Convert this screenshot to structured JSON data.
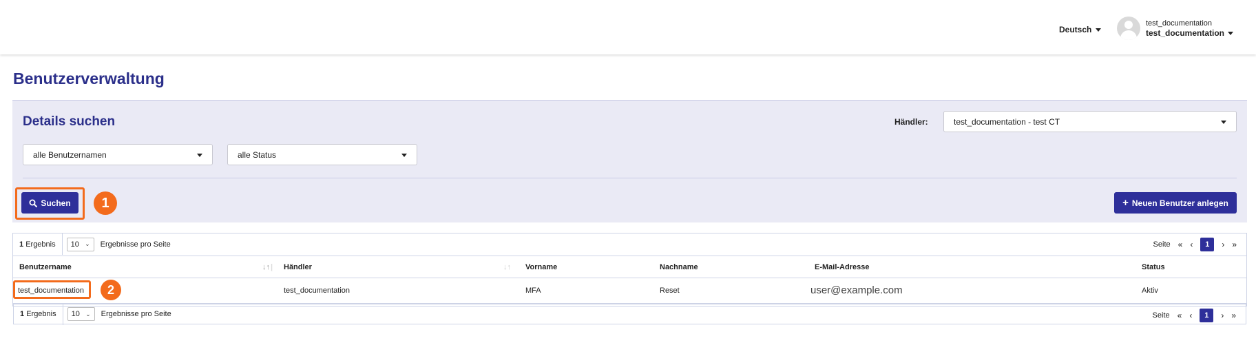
{
  "header": {
    "language": "Deutsch",
    "user_top": "test_documentation",
    "user_bottom": "test_documentation"
  },
  "page_title": "Benutzerverwaltung",
  "search_panel": {
    "title": "Details suchen",
    "haendler_label": "Händler:",
    "haendler_value": "test_documentation - test CT",
    "username_filter": "alle Benutzernamen",
    "status_filter": "alle Status",
    "search_button": "Suchen",
    "new_user_button": "Neuen Benutzer anlegen"
  },
  "callouts": [
    "1",
    "2"
  ],
  "table": {
    "result_count": "1",
    "result_label": "Ergebnis",
    "page_size": "10",
    "per_page_label": "Ergebnisse pro Seite",
    "page_label": "Seite",
    "current_page": "1",
    "pager": {
      "first": "«",
      "prev": "‹",
      "next": "›",
      "last": "»"
    },
    "columns": [
      "Benutzername",
      "Händler",
      "Vorname",
      "Nachname",
      "E-Mail-Adresse",
      "Status"
    ],
    "rows": [
      {
        "benutzername": "test_documentation",
        "haendler": "test_documentation",
        "vorname": "MFA",
        "nachname": "Reset",
        "email": "user@example.com",
        "status": "Aktiv"
      }
    ]
  },
  "colors": {
    "primary": "#2e2f9a",
    "title": "#2b2f8a",
    "panel_bg": "#eaeaf5",
    "highlight": "#f36b1c"
  },
  "icons": [
    "caret-down-icon",
    "user-avatar-icon",
    "search-icon",
    "plus-icon",
    "sort-icon",
    "chevron-down-icon"
  ]
}
